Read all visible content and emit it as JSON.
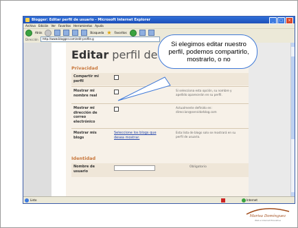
{
  "window": {
    "title": "Blogger: Editar perfil de usuario - Microsoft Internet Explorer",
    "menu": [
      "Archivo",
      "Edición",
      "Ver",
      "Favoritos",
      "Herramientas",
      "Ayuda"
    ],
    "toolbar": {
      "back": "Atrás",
      "search": "Búsqueda",
      "favorites": "Favoritos"
    },
    "address_label": "Dirección",
    "address": "http://www.blogger.com/edit-profile.g"
  },
  "page": {
    "heading_bold": "Editar",
    "heading_rest": " perfil de u",
    "privacy_title": "Privacidad",
    "rows": [
      {
        "label": "Compartir mi perfil",
        "desc": ""
      },
      {
        "label": "Mostrar mi nombre real",
        "desc": "Si selecciona esta opción, su nombre y apellido aparecerán en su perfil."
      },
      {
        "label": "Mostrar mi dirección de correo electrónico",
        "desc": "Actualmente definido en: direccion@servidorblog.com"
      },
      {
        "label": "Mostrar mis blogs",
        "link": "Seleccione los blogs que desea mostrar.",
        "desc": "Esta lista de blogs solo se mostrará en su perfil de usuario."
      }
    ],
    "identity_title": "Identidad",
    "username_label": "Nombre de usuario",
    "required": "Obligatorio"
  },
  "status": {
    "left": "Listo",
    "right": "Internet"
  },
  "callout": {
    "text": "Si elegimos editar nuestro perfil, podemos compartirlo, mostrarlo, o no"
  },
  "logo": {
    "name": "Marisa Domínguez",
    "sub": "Web e Internet Educativa"
  },
  "colors": {
    "accent": "#3d78d8",
    "section": "#c8763a",
    "titlebar": "#1d4fb8"
  }
}
